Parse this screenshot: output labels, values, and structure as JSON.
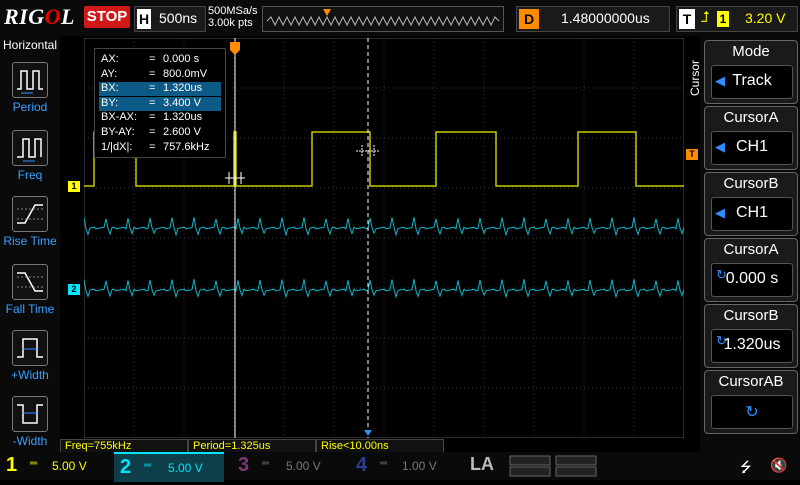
{
  "brand": "RIGOL",
  "run_state": "STOP",
  "horizontal": {
    "label": "H",
    "timebase": "500ns",
    "sample_rate": "500MSa/s",
    "points": "3.00k pts"
  },
  "delay": {
    "label": "D",
    "value": "1.48000000us"
  },
  "trigger": {
    "label": "T",
    "source": "1",
    "level": "3.20 V"
  },
  "left_menu": {
    "title": "Horizontal",
    "items": [
      {
        "label": "Period"
      },
      {
        "label": "Freq"
      },
      {
        "label": "Rise Time"
      },
      {
        "label": "Fall Time"
      },
      {
        "label": "+Width"
      },
      {
        "label": "-Width"
      }
    ]
  },
  "cursor_table": [
    {
      "key": "AX:",
      "value": "0.000 s",
      "highlight": false
    },
    {
      "key": "AY:",
      "value": "800.0mV",
      "highlight": false
    },
    {
      "key": "BX:",
      "value": "1.320us",
      "highlight": true
    },
    {
      "key": "BY:",
      "value": "3.400 V",
      "highlight": true
    },
    {
      "key": "BX-AX:",
      "value": "1.320us",
      "highlight": false
    },
    {
      "key": "BY-AY:",
      "value": "2.600 V",
      "highlight": false
    },
    {
      "key": "1/|dX|:",
      "value": "757.6kHz",
      "highlight": false
    }
  ],
  "measurements": {
    "freq": "Freq=755kHz",
    "period": "Period=1.325us",
    "rise": "Rise<10.00ns"
  },
  "right_menu": {
    "side_label": "Cursor",
    "mode": {
      "title": "Mode",
      "value": "Track"
    },
    "cursor_a_src": {
      "title": "CursorA",
      "value": "CH1"
    },
    "cursor_b_src": {
      "title": "CursorB",
      "value": "CH1"
    },
    "cursor_a_pos": {
      "title": "CursorA",
      "value": "0.000 s"
    },
    "cursor_b_pos": {
      "title": "CursorB",
      "value": "1.320us"
    },
    "cursor_ab": {
      "title": "CursorAB"
    }
  },
  "channels": [
    {
      "num": "1",
      "scale": "5.00 V",
      "color": "#ffff00"
    },
    {
      "num": "2",
      "scale": "5.00 V",
      "color": "#00e5ff"
    },
    {
      "num": "3",
      "scale": "5.00 V",
      "color": "#c040c0"
    },
    {
      "num": "4",
      "scale": "1.00 V",
      "color": "#3060ff"
    }
  ],
  "la_label": "LA",
  "colors": {
    "ch1": "#ffff00",
    "ch2": "#00e5ff",
    "accent": "#2f8fff",
    "stop": "#d01818",
    "trigger_marker": "#ff8c00"
  }
}
